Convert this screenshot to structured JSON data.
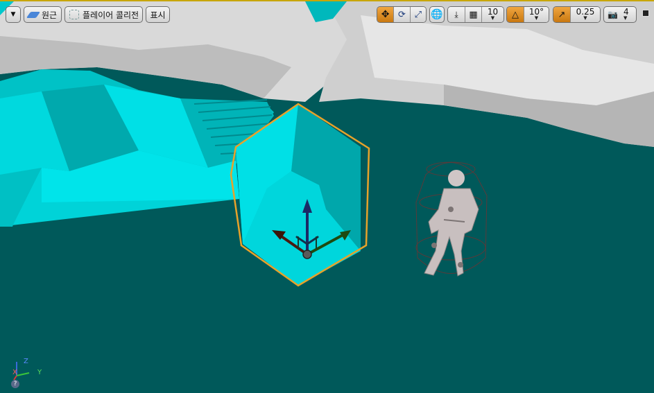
{
  "toolbar": {
    "view_mode_label": "원근",
    "show_mode_label": "플레이어 콜리전",
    "display_label": "표시",
    "grid_snap_value": "10",
    "rotation_snap_value": "10°",
    "scale_snap_value": "0.25",
    "camera_speed_value": "4"
  },
  "transform_modes": [
    "translate-icon",
    "rotate-icon",
    "scale-icon"
  ],
  "active_transform_mode": "translate",
  "axis_widget": {
    "x_label": "X",
    "y_label": "Y",
    "z_label": "Z"
  },
  "colors": {
    "floor": "#00595a",
    "cyan_mesh": "#00d3d8",
    "selection_outline": "#e8a22a",
    "toggle_active": "#e08a1e"
  }
}
